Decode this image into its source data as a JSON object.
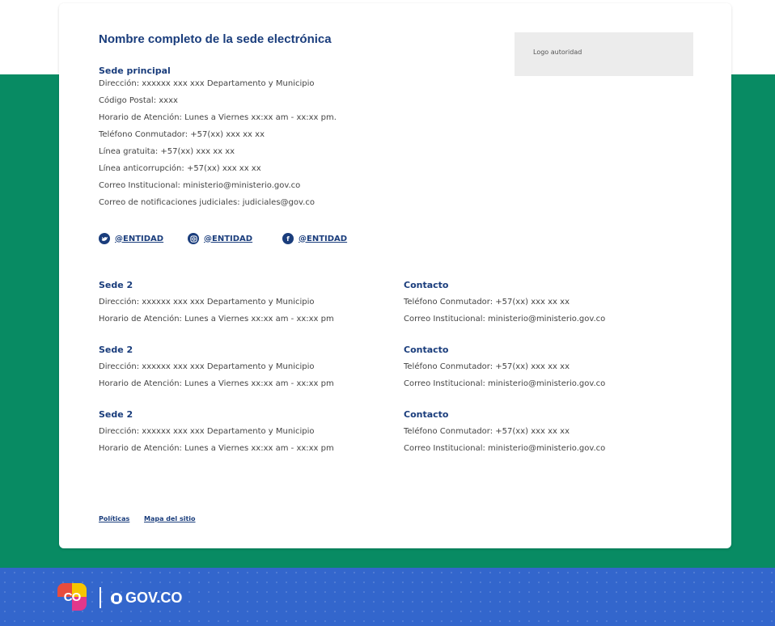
{
  "card": {
    "title": "Nombre completo de la sede electrónica",
    "logo_label": "Logo autoridad",
    "main_site": {
      "title": "Sede principal",
      "lines": [
        "Dirección: xxxxxx xxx xxx Departamento y Municipio",
        "Código Postal: xxxx",
        "Horario de Atención: Lunes a Viernes xx:xx am - xx:xx pm.",
        "Teléfono Conmutador: +57(xx) xxx xx xx",
        "Línea gratuita: +57(xx) xxx xx xx",
        "Línea anticorrupción: +57(xx) xxx xx xx",
        "Correo Institucional: ministerio@ministerio.gov.co",
        "Correo de notificaciones judiciales: judiciales@gov.co"
      ]
    },
    "social": [
      {
        "icon": "twitter-icon",
        "label": "@ENTIDAD"
      },
      {
        "icon": "instagram-icon",
        "label": "@ENTIDAD"
      },
      {
        "icon": "facebook-icon",
        "label": "@ENTIDAD"
      }
    ],
    "branches": [
      {
        "title": "Sede 2",
        "address": "Dirección: xxxxxx xxx xxx Departamento y Municipio",
        "hours": "Horario de Atención: Lunes a Viernes xx:xx am - xx:xx pm",
        "contact_title": "Contacto",
        "phone": "Teléfono Conmutador: +57(xx) xxx xx xx",
        "email": "Correo Institucional: ministerio@ministerio.gov.co"
      },
      {
        "title": "Sede 2",
        "address": "Dirección: xxxxxx xxx xxx Departamento y Municipio",
        "hours": "Horario de Atención: Lunes a Viernes xx:xx am - xx:xx pm",
        "contact_title": "Contacto",
        "phone": "Teléfono Conmutador: +57(xx) xxx xx xx",
        "email": "Correo Institucional: ministerio@ministerio.gov.co"
      },
      {
        "title": "Sede 2",
        "address": "Dirección: xxxxxx xxx xxx Departamento y Municipio",
        "hours": "Horario de Atención: Lunes a Viernes xx:xx am - xx:xx pm",
        "contact_title": "Contacto",
        "phone": "Teléfono Conmutador: +57(xx) xxx xx xx",
        "email": "Correo Institucional: ministerio@ministerio.gov.co"
      }
    ],
    "footer_links": {
      "policies": "Políticas",
      "sitemap": "Mapa del sitio"
    }
  },
  "footer": {
    "co_logo": "CO",
    "govco": "GOV.CO"
  },
  "colors": {
    "green": "#088b63",
    "blue": "#3366cc",
    "navy": "#1a3d7c"
  }
}
